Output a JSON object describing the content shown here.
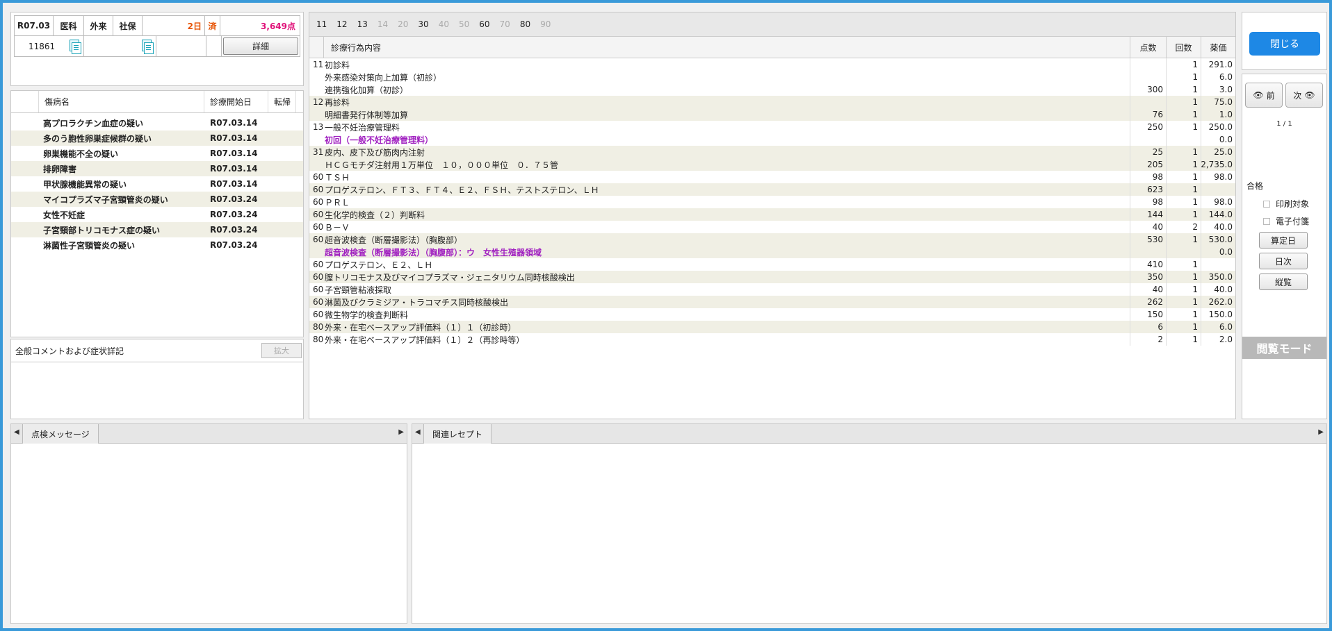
{
  "header": {
    "date": "R07.03",
    "dept": "医科",
    "type": "外来",
    "insurance": "社保",
    "days": "2日",
    "status": "済",
    "points": "3,649点",
    "patient_id": "11861",
    "detail_button": "詳細"
  },
  "disease": {
    "columns": {
      "name": "傷病名",
      "start": "診療開始日",
      "outcome": "転帰"
    },
    "rows": [
      {
        "name": "高プロラクチン血症の疑い",
        "date": "R07.03.14"
      },
      {
        "name": "多のう胞性卵巣症候群の疑い",
        "date": "R07.03.14"
      },
      {
        "name": "卵巣機能不全の疑い",
        "date": "R07.03.14"
      },
      {
        "name": "排卵障害",
        "date": "R07.03.14"
      },
      {
        "name": "甲状腺機能異常の疑い",
        "date": "R07.03.14"
      },
      {
        "name": "マイコプラズマ子宮頸管炎の疑い",
        "date": "R07.03.24"
      },
      {
        "name": "女性不妊症",
        "date": "R07.03.24"
      },
      {
        "name": "子宮頸部トリコモナス症の疑い",
        "date": "R07.03.24"
      },
      {
        "name": "淋菌性子宮頸管炎の疑い",
        "date": "R07.03.24"
      }
    ]
  },
  "comment": {
    "title": "全般コメントおよび症状詳記",
    "expand_button": "拡大"
  },
  "acts": {
    "tabs": [
      {
        "label": "11",
        "active": true
      },
      {
        "label": "12",
        "active": true
      },
      {
        "label": "13",
        "active": true
      },
      {
        "label": "14",
        "active": false
      },
      {
        "label": "20",
        "active": false
      },
      {
        "label": "30",
        "active": true
      },
      {
        "label": "40",
        "active": false
      },
      {
        "label": "50",
        "active": false
      },
      {
        "label": "60",
        "active": true
      },
      {
        "label": "70",
        "active": false
      },
      {
        "label": "80",
        "active": true
      },
      {
        "label": "90",
        "active": false
      }
    ],
    "columns": {
      "content": "診療行為内容",
      "points": "点数",
      "count": "回数",
      "drug": "薬価"
    },
    "rows": [
      {
        "code": "11",
        "name": "初診料",
        "pt": "",
        "cnt": "1",
        "yk": "291.0",
        "alt": false,
        "purple": false
      },
      {
        "code": "",
        "name": "外来感染対策向上加算（初診）",
        "pt": "",
        "cnt": "1",
        "yk": "6.0",
        "alt": false,
        "purple": false
      },
      {
        "code": "",
        "name": "連携強化加算（初診）",
        "pt": "300",
        "cnt": "1",
        "yk": "3.0",
        "alt": false,
        "purple": false
      },
      {
        "code": "12",
        "name": "再診料",
        "pt": "",
        "cnt": "1",
        "yk": "75.0",
        "alt": true,
        "purple": false
      },
      {
        "code": "",
        "name": "明細書発行体制等加算",
        "pt": "76",
        "cnt": "1",
        "yk": "1.0",
        "alt": true,
        "purple": false
      },
      {
        "code": "13",
        "name": "一般不妊治療管理料",
        "pt": "250",
        "cnt": "1",
        "yk": "250.0",
        "alt": false,
        "purple": false
      },
      {
        "code": "",
        "name": "初回（一般不妊治療管理料）",
        "pt": "",
        "cnt": "",
        "yk": "0.0",
        "alt": false,
        "purple": true
      },
      {
        "code": "31",
        "name": "皮内、皮下及び筋肉内注射",
        "pt": "25",
        "cnt": "1",
        "yk": "25.0",
        "alt": true,
        "purple": false
      },
      {
        "code": "",
        "name": "ＨＣＧモチダ注射用１万単位　１０，０００単位　０．７５管",
        "pt": "205",
        "cnt": "1",
        "yk": "2,735.0",
        "alt": true,
        "purple": false
      },
      {
        "code": "60",
        "name": "ＴＳＨ",
        "pt": "98",
        "cnt": "1",
        "yk": "98.0",
        "alt": false,
        "purple": false
      },
      {
        "code": "60",
        "name": "プロゲステロン、ＦＴ３、ＦＴ４、Ｅ２、ＦＳＨ、テストステロン、ＬＨ",
        "pt": "623",
        "cnt": "1",
        "yk": "",
        "alt": true,
        "purple": false
      },
      {
        "code": "60",
        "name": "ＰＲＬ",
        "pt": "98",
        "cnt": "1",
        "yk": "98.0",
        "alt": false,
        "purple": false
      },
      {
        "code": "60",
        "name": "生化学的検査（２）判断料",
        "pt": "144",
        "cnt": "1",
        "yk": "144.0",
        "alt": true,
        "purple": false
      },
      {
        "code": "60",
        "name": "Ｂ－Ｖ",
        "pt": "40",
        "cnt": "2",
        "yk": "40.0",
        "alt": false,
        "purple": false
      },
      {
        "code": "60",
        "name": "超音波検査（断層撮影法）（胸腹部）",
        "pt": "530",
        "cnt": "1",
        "yk": "530.0",
        "alt": true,
        "purple": false
      },
      {
        "code": "",
        "name": "超音波検査（断層撮影法）（胸腹部）：ウ　女性生殖器領域",
        "pt": "",
        "cnt": "",
        "yk": "0.0",
        "alt": true,
        "purple": true
      },
      {
        "code": "60",
        "name": "プロゲステロン、Ｅ２、ＬＨ",
        "pt": "410",
        "cnt": "1",
        "yk": "",
        "alt": false,
        "purple": false
      },
      {
        "code": "60",
        "name": "膣トリコモナス及びマイコプラズマ・ジェニタリウム同時核酸検出",
        "pt": "350",
        "cnt": "1",
        "yk": "350.0",
        "alt": true,
        "purple": false
      },
      {
        "code": "60",
        "name": "子宮頸管粘液採取",
        "pt": "40",
        "cnt": "1",
        "yk": "40.0",
        "alt": false,
        "purple": false
      },
      {
        "code": "60",
        "name": "淋菌及びクラミジア・トラコマチス同時核酸検出",
        "pt": "262",
        "cnt": "1",
        "yk": "262.0",
        "alt": true,
        "purple": false
      },
      {
        "code": "60",
        "name": "微生物学的検査判断料",
        "pt": "150",
        "cnt": "1",
        "yk": "150.0",
        "alt": false,
        "purple": false
      },
      {
        "code": "80",
        "name": "外来・在宅ベースアップ評価料（１）１（初診時）",
        "pt": "6",
        "cnt": "1",
        "yk": "6.0",
        "alt": true,
        "purple": false
      },
      {
        "code": "80",
        "name": "外来・在宅ベースアップ評価料（１）２（再診時等）",
        "pt": "2",
        "cnt": "1",
        "yk": "2.0",
        "alt": false,
        "purple": false
      }
    ]
  },
  "right": {
    "close_button": "閉じる",
    "prev_button": "前",
    "next_button": "次",
    "page": "1 / 1",
    "result": "合格",
    "print_target": "印刷対象",
    "electronic_attach": "電子付箋",
    "calc_day_button": "算定日",
    "daily_button": "日次",
    "overview_button": "縦覧",
    "mode_label": "閲覧モード"
  },
  "bottom": {
    "check_tab": "点検メッセージ",
    "related_tab": "関連レセプト"
  },
  "icons": {
    "eye": "eye-icon",
    "document": "document-icon",
    "arrow_left": "arrow-left-icon",
    "arrow_right": "arrow-right-icon"
  },
  "colors": {
    "accent": "#1e88e5",
    "frame": "#3a9ad9",
    "purple": "#a020c0",
    "orange": "#e65100",
    "pink": "#e0127a"
  }
}
